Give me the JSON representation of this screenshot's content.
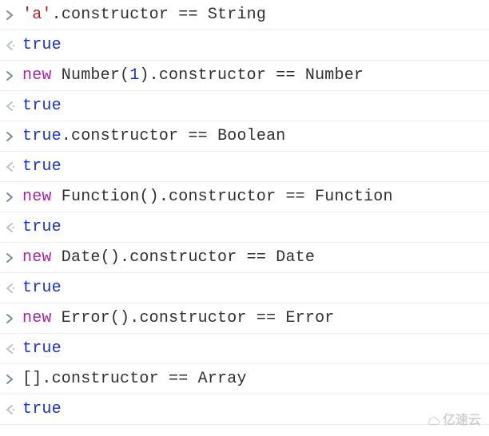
{
  "colors": {
    "arrow_in": "#7a8aa0",
    "arrow_out": "#b9c2cc",
    "string": "#b12222",
    "keyword": "#a626a4",
    "number": "#1a34c2",
    "boolean": "#1a34c2",
    "text": "#303030"
  },
  "watermark": "亿速云",
  "entries": [
    {
      "input": [
        {
          "t": "str",
          "v": "'a'"
        },
        {
          "t": "pun",
          "v": "."
        },
        {
          "t": "id",
          "v": "constructor"
        },
        {
          "t": "op",
          "v": " == "
        },
        {
          "t": "id",
          "v": "String"
        }
      ],
      "output": [
        {
          "t": "bool",
          "v": "true"
        }
      ]
    },
    {
      "input": [
        {
          "t": "kw",
          "v": "new"
        },
        {
          "t": "id",
          "v": " Number"
        },
        {
          "t": "pun",
          "v": "("
        },
        {
          "t": "num",
          "v": "1"
        },
        {
          "t": "pun",
          "v": ")."
        },
        {
          "t": "id",
          "v": "constructor"
        },
        {
          "t": "op",
          "v": " == "
        },
        {
          "t": "id",
          "v": "Number"
        }
      ],
      "output": [
        {
          "t": "bool",
          "v": "true"
        }
      ]
    },
    {
      "input": [
        {
          "t": "bool",
          "v": "true"
        },
        {
          "t": "pun",
          "v": "."
        },
        {
          "t": "id",
          "v": "constructor"
        },
        {
          "t": "op",
          "v": " == "
        },
        {
          "t": "id",
          "v": "Boolean"
        }
      ],
      "output": [
        {
          "t": "bool",
          "v": "true"
        }
      ]
    },
    {
      "input": [
        {
          "t": "kw",
          "v": "new"
        },
        {
          "t": "id",
          "v": " Function"
        },
        {
          "t": "pun",
          "v": "()."
        },
        {
          "t": "id",
          "v": "constructor"
        },
        {
          "t": "op",
          "v": " == "
        },
        {
          "t": "id",
          "v": "Function"
        }
      ],
      "output": [
        {
          "t": "bool",
          "v": "true"
        }
      ]
    },
    {
      "input": [
        {
          "t": "kw",
          "v": "new"
        },
        {
          "t": "id",
          "v": " Date"
        },
        {
          "t": "pun",
          "v": "()."
        },
        {
          "t": "id",
          "v": "constructor"
        },
        {
          "t": "op",
          "v": " == "
        },
        {
          "t": "id",
          "v": "Date"
        }
      ],
      "output": [
        {
          "t": "bool",
          "v": "true"
        }
      ]
    },
    {
      "input": [
        {
          "t": "kw",
          "v": "new"
        },
        {
          "t": "id",
          "v": " Error"
        },
        {
          "t": "pun",
          "v": "()."
        },
        {
          "t": "id",
          "v": "constructor"
        },
        {
          "t": "op",
          "v": " == "
        },
        {
          "t": "id",
          "v": "Error"
        }
      ],
      "output": [
        {
          "t": "bool",
          "v": "true"
        }
      ]
    },
    {
      "input": [
        {
          "t": "pun",
          "v": "[]"
        },
        {
          "t": "pun",
          "v": "."
        },
        {
          "t": "id",
          "v": "constructor"
        },
        {
          "t": "op",
          "v": " == "
        },
        {
          "t": "id",
          "v": "Array"
        }
      ],
      "output": [
        {
          "t": "bool",
          "v": "true"
        }
      ]
    }
  ]
}
